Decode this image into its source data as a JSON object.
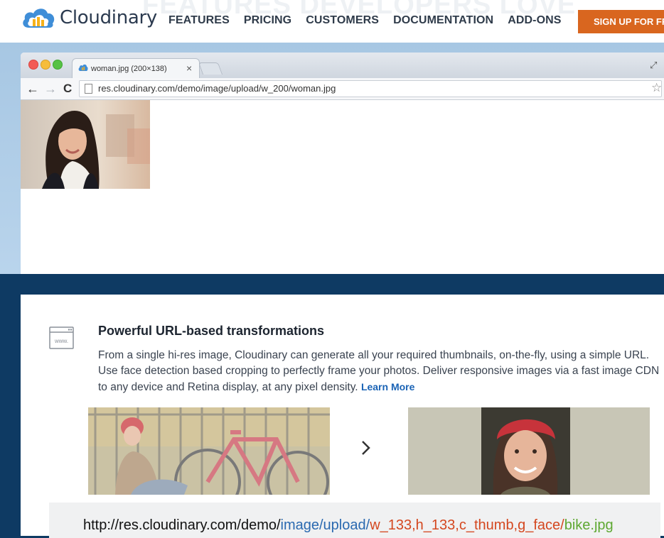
{
  "nav": {
    "logo_text": "Cloudinary",
    "hero_title": "FEATURES DEVELOPERS LOVE",
    "links": [
      "FEATURES",
      "PRICING",
      "CUSTOMERS",
      "DOCUMENTATION",
      "ADD-ONS"
    ],
    "signup_label": "SIGN UP FOR FREE"
  },
  "browser": {
    "tab_title": "woman.jpg (200×138)",
    "tab_close": "×",
    "url": "res.cloudinary.com/demo/image/upload/w_200/woman.jpg",
    "back_icon": "←",
    "forward_icon": "→",
    "reload_icon": "C",
    "star_icon": "☆",
    "fullscreen_icon": "⤢"
  },
  "feature": {
    "title": "Powerful URL-based transformations",
    "description": "From a single hi-res image, Cloudinary can generate all your required thumbnails, on-the-fly, using a simple URL. Use face detection based cropping to perfectly frame your photos. Deliver responsive images via a fast image CDN to any device and Retina display, at any pixel density.",
    "learn_more": "Learn More",
    "www_icon_text": "www."
  },
  "example_url": {
    "base": "http://res.cloudinary.com/demo/",
    "path": "image/upload/",
    "transformation": "w_133,h_133,c_thumb,g_face/",
    "file": "bike.jpg"
  },
  "colors": {
    "signup": "#d9661f",
    "dark_band": "#0e3a63",
    "learn_more": "#1a63b5",
    "url_path": "#2a69b0",
    "url_transformation": "#d4471f",
    "url_file": "#5ea832"
  }
}
